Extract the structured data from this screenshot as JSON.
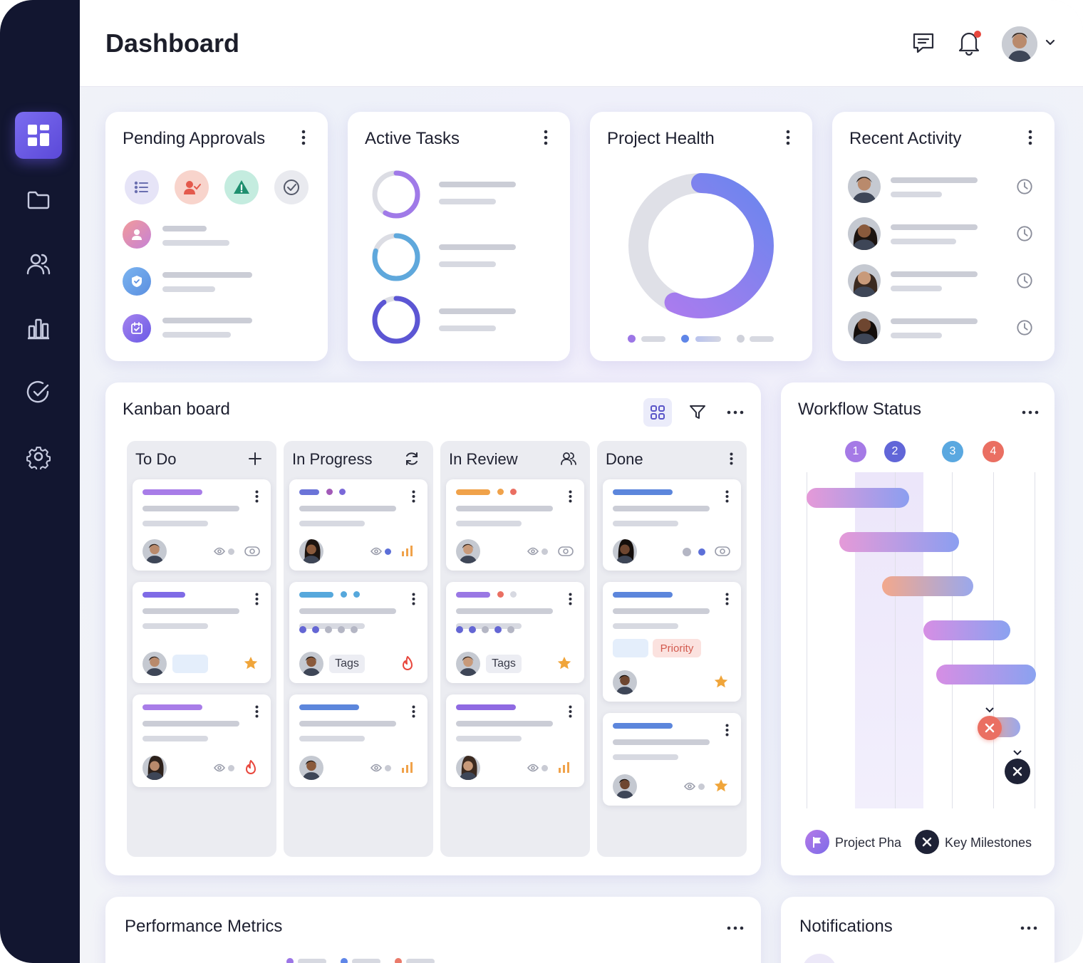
{
  "header": {
    "title": "Dashboard"
  },
  "sidebar": {
    "items": [
      {
        "icon": "dashboard-icon",
        "active": true
      },
      {
        "icon": "folder-icon"
      },
      {
        "icon": "users-icon"
      },
      {
        "icon": "bar-chart-icon"
      },
      {
        "icon": "check-circle-icon"
      },
      {
        "icon": "settings-icon"
      }
    ]
  },
  "cards": {
    "pending_approvals": {
      "title": "Pending Approvals"
    },
    "active_tasks": {
      "title": "Active Tasks"
    },
    "project_health": {
      "title": "Project Health"
    },
    "recent_activity": {
      "title": "Recent Activity"
    }
  },
  "kanban": {
    "title": "Kanban board",
    "columns": [
      {
        "title": "To Do"
      },
      {
        "title": "In Progress"
      },
      {
        "title": "In Review"
      },
      {
        "title": "Done"
      }
    ],
    "tags": {
      "tags_label": "Tags",
      "priority_label": "Priority"
    }
  },
  "workflow": {
    "title": "Workflow Status",
    "steps": [
      "1",
      "2",
      "3",
      "4"
    ],
    "legend": {
      "phase": "Project Pha",
      "milestones": "Key Milestones"
    }
  },
  "performance": {
    "title": "Performance Metrics"
  },
  "notifications": {
    "title": "Notifications"
  },
  "colors": {
    "sidebar": "#121630",
    "accent": "#6a5ae6",
    "danger": "#ea6f62"
  }
}
